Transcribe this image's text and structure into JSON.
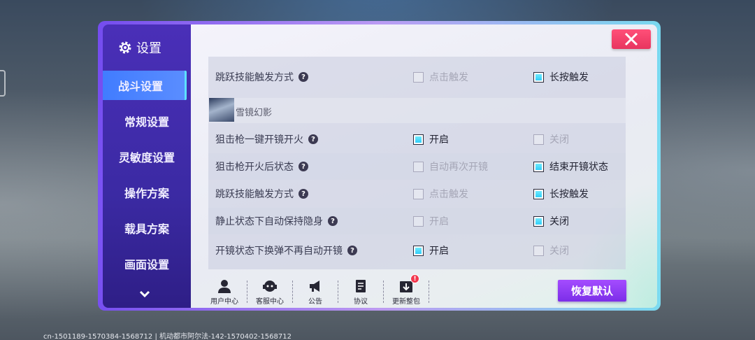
{
  "sidebar": {
    "title": "设置",
    "items": [
      {
        "label": "战斗设置",
        "active": true
      },
      {
        "label": "常规设置",
        "active": false
      },
      {
        "label": "灵敏度设置",
        "active": false
      },
      {
        "label": "操作方案",
        "active": false
      },
      {
        "label": "载具方案",
        "active": false
      },
      {
        "label": "画面设置",
        "active": false
      }
    ]
  },
  "settings": {
    "rows": [
      {
        "label": "跳跃技能触发方式",
        "opt1": "点击触发",
        "opt2": "长按触发",
        "selected": 2
      },
      {
        "label": "狙击枪一键开镜开火",
        "opt1": "开启",
        "opt2": "关闭",
        "selected": 1
      },
      {
        "label": "狙击枪开火后状态",
        "opt1": "自动再次开镜",
        "opt2": "结束开镜状态",
        "selected": 2
      },
      {
        "label": "跳跃技能触发方式",
        "opt1": "点击触发",
        "opt2": "长按触发",
        "selected": 2
      },
      {
        "label": "静止状态下自动保持隐身",
        "opt1": "开启",
        "opt2": "关闭",
        "selected": 2
      },
      {
        "label": "开镜状态下换弹不再自动开镜",
        "opt1": "开启",
        "opt2": "关闭",
        "selected": 1
      }
    ],
    "section_title": "雪镜幻影",
    "help_glyph": "?"
  },
  "bottom_bar": {
    "items": [
      {
        "label": "用户中心",
        "icon": "user-icon"
      },
      {
        "label": "客服中心",
        "icon": "headset-icon"
      },
      {
        "label": "公告",
        "icon": "megaphone-icon"
      },
      {
        "label": "协议",
        "icon": "document-icon"
      },
      {
        "label": "更新整包",
        "icon": "download-icon",
        "badge": "!"
      }
    ],
    "restore_label": "恢复默认"
  },
  "footer": {
    "info": "cn-1501189-1570384-1568712 | 机动都市阿尔法-142-1570402-1568712"
  },
  "colors": {
    "accent": "#3f7bff",
    "close": "#f0406a",
    "restore": "#8e3cf4",
    "checkbox_on": "#22c7f7"
  }
}
